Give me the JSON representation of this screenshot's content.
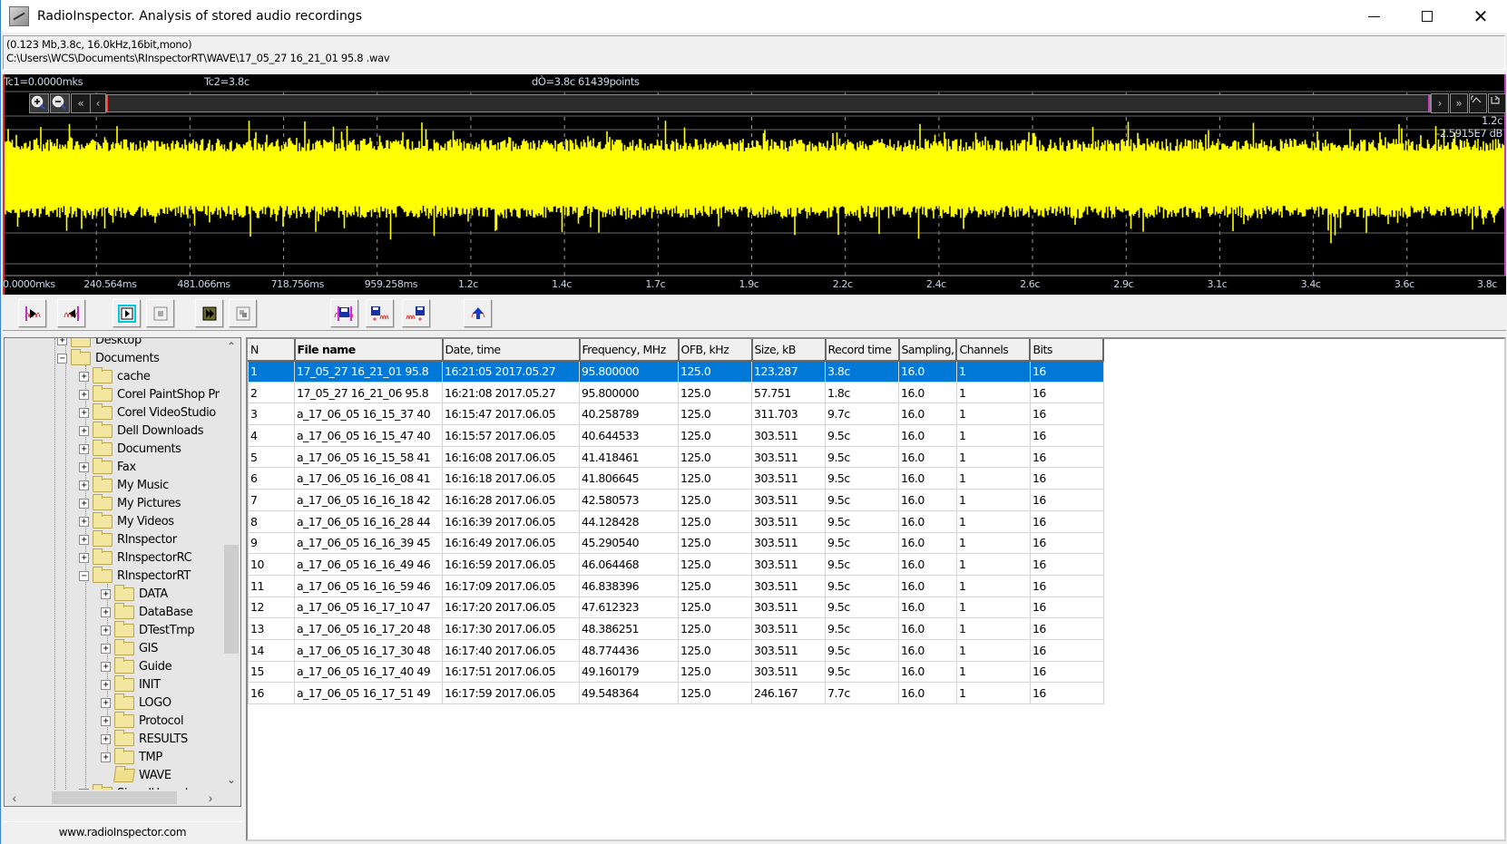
{
  "window": {
    "title": "RadioInspector. Analysis of stored audio recordings",
    "controls": {
      "minimize": "minimize",
      "maximize": "maximize",
      "close": "✕"
    }
  },
  "file_info": {
    "summary": "(0.123 Mb,3.8c,  16.0kHz,16bit,mono)",
    "path": "C:\\Users\\WCS\\Documents\\RInspectorRT\\WAVE\\17_05_27  16_21_01 95.8 .wav"
  },
  "scope": {
    "tc1": "Tc1=0.0000mks",
    "tc2": "Tc2=3.8c",
    "delta": "dÒ=3.8c 61439points",
    "scale_time": "1.2c",
    "scale_db": "-2.5915E7 dB",
    "trace_color": "#ffff00",
    "background_color": "#000000",
    "buttons": {
      "zoom_in": "zoom-in",
      "zoom_out": "zoom-out",
      "first": "«",
      "prev": "‹",
      "next": "›",
      "last": "»",
      "fit": "fit",
      "undo": "undo"
    },
    "axis_ticks": [
      "0.0000mks",
      "240.564ms",
      "481.066ms",
      "718.756ms",
      "959.258ms",
      "1.2c",
      "1.4c",
      "1.7c",
      "1.9c",
      "2.2c",
      "2.4c",
      "2.6c",
      "2.9c",
      "3.1c",
      "3.4c",
      "3.6c",
      "3.8c"
    ]
  },
  "toolbar": {
    "buttons": [
      {
        "name": "cursor-left-button",
        "icon": "cursor-left-icon"
      },
      {
        "name": "cursor-right-button",
        "icon": "cursor-right-icon"
      },
      {
        "name": "play-button",
        "icon": "play-icon"
      },
      {
        "name": "stop-button",
        "icon": "stop-icon"
      },
      {
        "name": "play-loop-button",
        "icon": "play-loop-icon"
      },
      {
        "name": "copy-fragment-button",
        "icon": "copy-fragment-icon"
      },
      {
        "name": "save-selection-button",
        "icon": "save-selection-icon"
      },
      {
        "name": "save-right-button",
        "icon": "save-right-icon"
      },
      {
        "name": "save-left-button",
        "icon": "save-left-icon"
      },
      {
        "name": "export-button",
        "icon": "export-icon"
      }
    ]
  },
  "tree": {
    "items": [
      {
        "label": "Desktop",
        "level": 0,
        "expander": "+"
      },
      {
        "label": "Documents",
        "level": 0,
        "expander": "−"
      },
      {
        "label": "cache",
        "level": 1,
        "expander": "+"
      },
      {
        "label": "Corel PaintShop Pr",
        "level": 1,
        "expander": "+"
      },
      {
        "label": "Corel VideoStudio",
        "level": 1,
        "expander": "+"
      },
      {
        "label": "Dell Downloads",
        "level": 1,
        "expander": "+"
      },
      {
        "label": "Documents",
        "level": 1,
        "expander": "+"
      },
      {
        "label": "Fax",
        "level": 1,
        "expander": "+"
      },
      {
        "label": "My Music",
        "level": 1,
        "expander": "+"
      },
      {
        "label": "My Pictures",
        "level": 1,
        "expander": "+"
      },
      {
        "label": "My Videos",
        "level": 1,
        "expander": "+"
      },
      {
        "label": "RInspector",
        "level": 1,
        "expander": "+"
      },
      {
        "label": "RInspectorRC",
        "level": 1,
        "expander": "+"
      },
      {
        "label": "RInspectorRT",
        "level": 1,
        "expander": "−"
      },
      {
        "label": "DATA",
        "level": 2,
        "expander": "+"
      },
      {
        "label": "DataBase",
        "level": 2,
        "expander": "+"
      },
      {
        "label": "DTestTmp",
        "level": 2,
        "expander": "+"
      },
      {
        "label": "GIS",
        "level": 2,
        "expander": "+"
      },
      {
        "label": "Guide",
        "level": 2,
        "expander": "+"
      },
      {
        "label": "INIT",
        "level": 2,
        "expander": "+"
      },
      {
        "label": "LOGO",
        "level": 2,
        "expander": "+"
      },
      {
        "label": "Protocol",
        "level": 2,
        "expander": "+"
      },
      {
        "label": "RESULTS",
        "level": 2,
        "expander": "+"
      },
      {
        "label": "TMP",
        "level": 2,
        "expander": "+"
      },
      {
        "label": "WAVE",
        "level": 2,
        "expander": "",
        "open": true
      },
      {
        "label": "SignalHound",
        "level": 1,
        "expander": "+"
      }
    ],
    "footer": "www.radioInspector.com"
  },
  "table": {
    "columns": [
      "N",
      "File name",
      "Date, time",
      "Frequency, MHz",
      "OFB, kHz",
      "Size, kB",
      "Record time",
      "Sampling,",
      "Channels",
      "Bits"
    ],
    "selected_index": 0,
    "rows": [
      [
        "1",
        "17_05_27  16_21_01 95.8",
        "16:21:05 2017.05.27",
        "95.800000",
        "125.0",
        "123.287",
        "3.8c",
        "16.0",
        "1",
        "16"
      ],
      [
        "2",
        "17_05_27  16_21_06 95.8",
        "16:21:08 2017.05.27",
        "95.800000",
        "125.0",
        "57.751",
        "1.8c",
        "16.0",
        "1",
        "16"
      ],
      [
        "3",
        "a_17_06_05  16_15_37 40",
        "16:15:47 2017.06.05",
        "40.258789",
        "125.0",
        "311.703",
        "9.7c",
        "16.0",
        "1",
        "16"
      ],
      [
        "4",
        "a_17_06_05  16_15_47 40",
        "16:15:57 2017.06.05",
        "40.644533",
        "125.0",
        "303.511",
        "9.5c",
        "16.0",
        "1",
        "16"
      ],
      [
        "5",
        "a_17_06_05  16_15_58 41",
        "16:16:08 2017.06.05",
        "41.418461",
        "125.0",
        "303.511",
        "9.5c",
        "16.0",
        "1",
        "16"
      ],
      [
        "6",
        "a_17_06_05  16_16_08 41",
        "16:16:18 2017.06.05",
        "41.806645",
        "125.0",
        "303.511",
        "9.5c",
        "16.0",
        "1",
        "16"
      ],
      [
        "7",
        "a_17_06_05  16_16_18 42",
        "16:16:28 2017.06.05",
        "42.580573",
        "125.0",
        "303.511",
        "9.5c",
        "16.0",
        "1",
        "16"
      ],
      [
        "8",
        "a_17_06_05  16_16_28 44",
        "16:16:39 2017.06.05",
        "44.128428",
        "125.0",
        "303.511",
        "9.5c",
        "16.0",
        "1",
        "16"
      ],
      [
        "9",
        "a_17_06_05  16_16_39 45",
        "16:16:49 2017.06.05",
        "45.290540",
        "125.0",
        "303.511",
        "9.5c",
        "16.0",
        "1",
        "16"
      ],
      [
        "10",
        "a_17_06_05  16_16_49 46",
        "16:16:59 2017.06.05",
        "46.064468",
        "125.0",
        "303.511",
        "9.5c",
        "16.0",
        "1",
        "16"
      ],
      [
        "11",
        "a_17_06_05  16_16_59 46",
        "16:17:09 2017.06.05",
        "46.838396",
        "125.0",
        "303.511",
        "9.5c",
        "16.0",
        "1",
        "16"
      ],
      [
        "12",
        "a_17_06_05  16_17_10 47",
        "16:17:20 2017.06.05",
        "47.612323",
        "125.0",
        "303.511",
        "9.5c",
        "16.0",
        "1",
        "16"
      ],
      [
        "13",
        "a_17_06_05  16_17_20 48",
        "16:17:30 2017.06.05",
        "48.386251",
        "125.0",
        "303.511",
        "9.5c",
        "16.0",
        "1",
        "16"
      ],
      [
        "14",
        "a_17_06_05  16_17_30 48",
        "16:17:40 2017.06.05",
        "48.774436",
        "125.0",
        "303.511",
        "9.5c",
        "16.0",
        "1",
        "16"
      ],
      [
        "15",
        "a_17_06_05  16_17_40 49",
        "16:17:51 2017.06.05",
        "49.160179",
        "125.0",
        "303.511",
        "9.5c",
        "16.0",
        "1",
        "16"
      ],
      [
        "16",
        "a_17_06_05  16_17_51 49",
        "16:17:59 2017.06.05",
        "49.548364",
        "125.0",
        "246.167",
        "7.7c",
        "16.0",
        "1",
        "16"
      ]
    ]
  }
}
